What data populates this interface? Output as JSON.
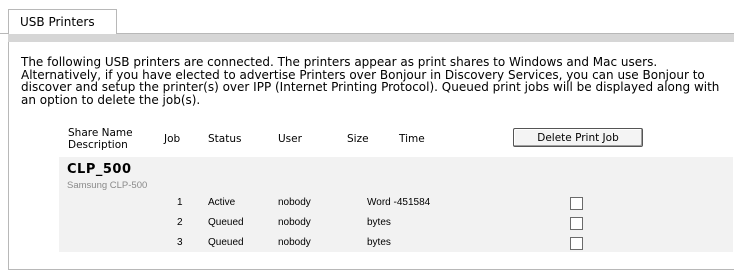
{
  "tab": {
    "label": "USB Printers"
  },
  "description": "The following USB printers are connected. The printers appear as print shares to Windows and Mac users. Alternatively, if you have elected to advertise Printers over Bonjour in Discovery Services, you can use Bonjour to discover and setup the printer(s) over IPP (Internet Printing Protocol). Queued print jobs will be displayed along with an option to delete the job(s).",
  "table": {
    "headers": {
      "share_name": "Share Name",
      "description": "Description",
      "job": "Job",
      "status": "Status",
      "user": "User",
      "size": "Size",
      "time": "Time"
    },
    "delete_button": "Delete Print Job"
  },
  "printer": {
    "name": "CLP_500",
    "model": "Samsung CLP-500",
    "jobs": [
      {
        "job": "1",
        "status": "Active",
        "user": "nobody",
        "size": "Word -451584"
      },
      {
        "job": "2",
        "status": "Queued",
        "user": "nobody",
        "size": "bytes"
      },
      {
        "job": "3",
        "status": "Queued",
        "user": "nobody",
        "size": "bytes"
      }
    ]
  }
}
